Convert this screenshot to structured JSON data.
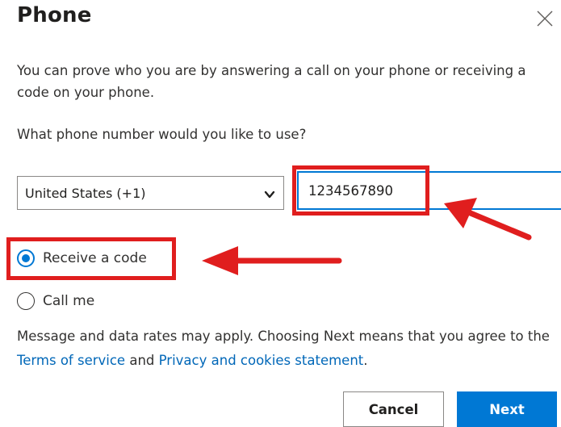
{
  "dialog": {
    "title": "Phone",
    "description": "You can prove who you are by answering a call on your phone or receiving a code on your phone.",
    "question": "What phone number would you like to use?",
    "country_select": {
      "selected": "United States (+1)"
    },
    "phone_input": {
      "value": "1234567890"
    },
    "options": [
      {
        "label": "Receive a code",
        "checked": true
      },
      {
        "label": "Call me",
        "checked": false
      }
    ],
    "disclaimer": {
      "prefix": "Message and data rates may apply. Choosing Next means that you agree to the ",
      "terms_link": "Terms of service",
      "middle": " and ",
      "privacy_link": "Privacy and cookies statement",
      "suffix": "."
    },
    "buttons": {
      "cancel": "Cancel",
      "next": "Next"
    }
  },
  "icons": {
    "close": "close-icon",
    "select_chevron": "chevron-down-icon"
  },
  "annotations": {
    "highlight_color": "#e01e1e"
  },
  "colors": {
    "accent": "#0078d4",
    "link": "#0067b8",
    "text": "#323130"
  }
}
